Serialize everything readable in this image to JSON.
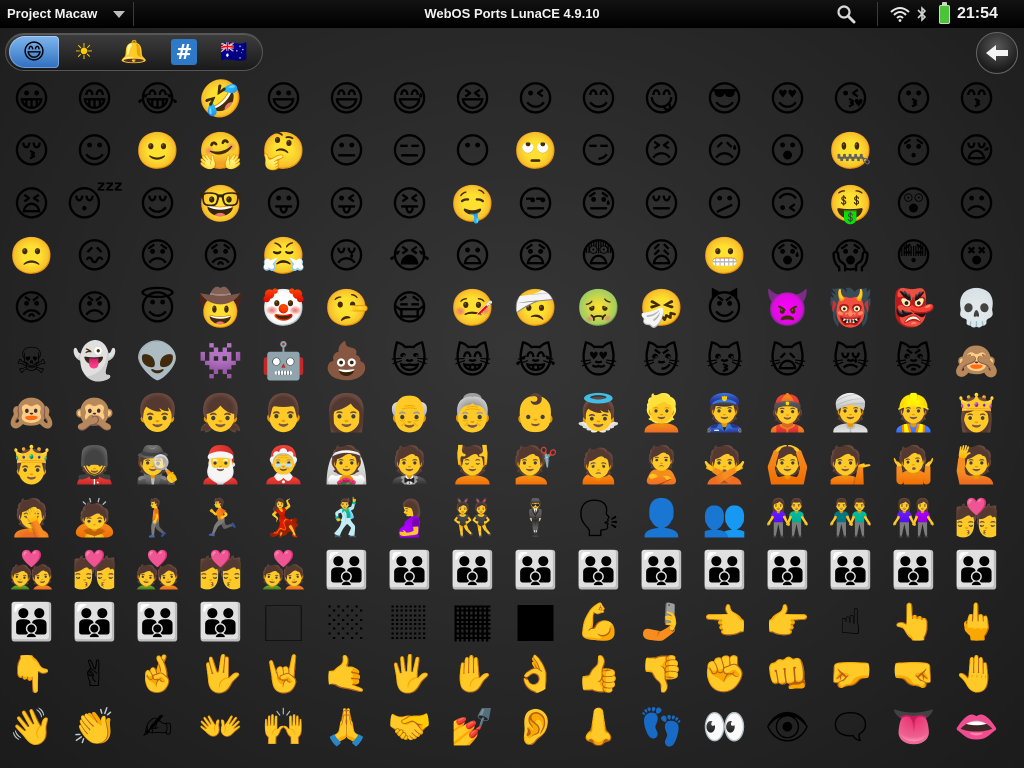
{
  "status_bar": {
    "app_name": "Project Macaw",
    "title": "WebOS Ports LunaCE 4.9.10",
    "clock": "21:54",
    "icons": [
      "search-icon",
      "wifi-icon",
      "bluetooth-icon",
      "battery-icon"
    ]
  },
  "categories": [
    {
      "name": "people",
      "glyph": "😄",
      "selected": true
    },
    {
      "name": "nature",
      "glyph": "☀",
      "selected": false
    },
    {
      "name": "objects",
      "glyph": "🔔",
      "selected": false
    },
    {
      "name": "symbols",
      "glyph": "#",
      "selected": false
    },
    {
      "name": "flags",
      "glyph": "🇦🇺",
      "selected": false
    }
  ],
  "back_button": {
    "icon": "back-arrow-icon"
  },
  "emoji_grid": [
    [
      "😀",
      "😁",
      "😂",
      "🤣",
      "😃",
      "😄",
      "😅",
      "😆",
      "😉",
      "😊",
      "😋",
      "😎",
      "😍",
      "😘",
      "😗",
      "😙"
    ],
    [
      "😚",
      "☺",
      "🙂",
      "🤗",
      "🤔",
      "😐",
      "😑",
      "😶",
      "🙄",
      "😏",
      "😣",
      "😥",
      "😮",
      "🤐",
      "😯",
      "😪"
    ],
    [
      "😫",
      "😴",
      "😌",
      "🤓",
      "😛",
      "😜",
      "😝",
      "🤤",
      "😒",
      "😓",
      "😔",
      "😕",
      "🙃",
      "🤑",
      "😲",
      "☹"
    ],
    [
      "🙁",
      "😖",
      "😞",
      "😟",
      "😤",
      "😢",
      "😭",
      "😦",
      "😧",
      "😨",
      "😩",
      "😬",
      "😰",
      "😱",
      "😳",
      "😵"
    ],
    [
      "😡",
      "😠",
      "😇",
      "🤠",
      "🤡",
      "🤥",
      "😷",
      "🤒",
      "🤕",
      "🤢",
      "🤧",
      "😈",
      "👿",
      "👹",
      "👺",
      "💀"
    ],
    [
      "☠",
      "👻",
      "👽",
      "👾",
      "🤖",
      "💩",
      "😺",
      "😸",
      "😹",
      "😻",
      "😼",
      "😽",
      "🙀",
      "😿",
      "😾",
      "🙈"
    ],
    [
      "🙉",
      "🙊",
      "👦",
      "👧",
      "👨",
      "👩",
      "👴",
      "👵",
      "👶",
      "👼",
      "👱",
      "👮",
      "👲",
      "👳",
      "👷",
      "👸"
    ],
    [
      "🤴",
      "💂",
      "🕵",
      "🎅",
      "🤶",
      "👰",
      "🤵",
      "💆",
      "💇",
      "🙍",
      "🙎",
      "🙅",
      "🙆",
      "💁",
      "🤷",
      "🙋"
    ],
    [
      "🤦",
      "🙇",
      "🚶",
      "🏃",
      "💃",
      "🕺",
      "🤰",
      "👯",
      "🕴",
      "🗣",
      "👤",
      "👥",
      "👫",
      "👬",
      "👭",
      "💏"
    ],
    [
      "💑",
      "💏",
      "💑",
      "💏",
      "💑",
      "👪",
      "👪",
      "👪",
      "👪",
      "👪",
      "👪",
      "👪",
      "👪",
      "👪",
      "👪",
      "👪"
    ],
    [
      "👪",
      "👪",
      "👪",
      "👪",
      "🏻",
      "🏼",
      "🏽",
      "🏾",
      "🏿",
      "💪",
      "🤳",
      "👈",
      "👉",
      "☝",
      "👆",
      "🖕"
    ],
    [
      "👇",
      "✌",
      "🤞",
      "🖖",
      "🤘",
      "🤙",
      "🖐",
      "✋",
      "👌",
      "👍",
      "👎",
      "✊",
      "👊",
      "🤛",
      "🤜",
      "🤚"
    ],
    [
      "👋",
      "👏",
      "✍",
      "👐",
      "🙌",
      "🙏",
      "🤝",
      "💅",
      "👂",
      "👃",
      "👣",
      "👀",
      "👁",
      "🗨",
      "👅",
      "👄"
    ]
  ]
}
